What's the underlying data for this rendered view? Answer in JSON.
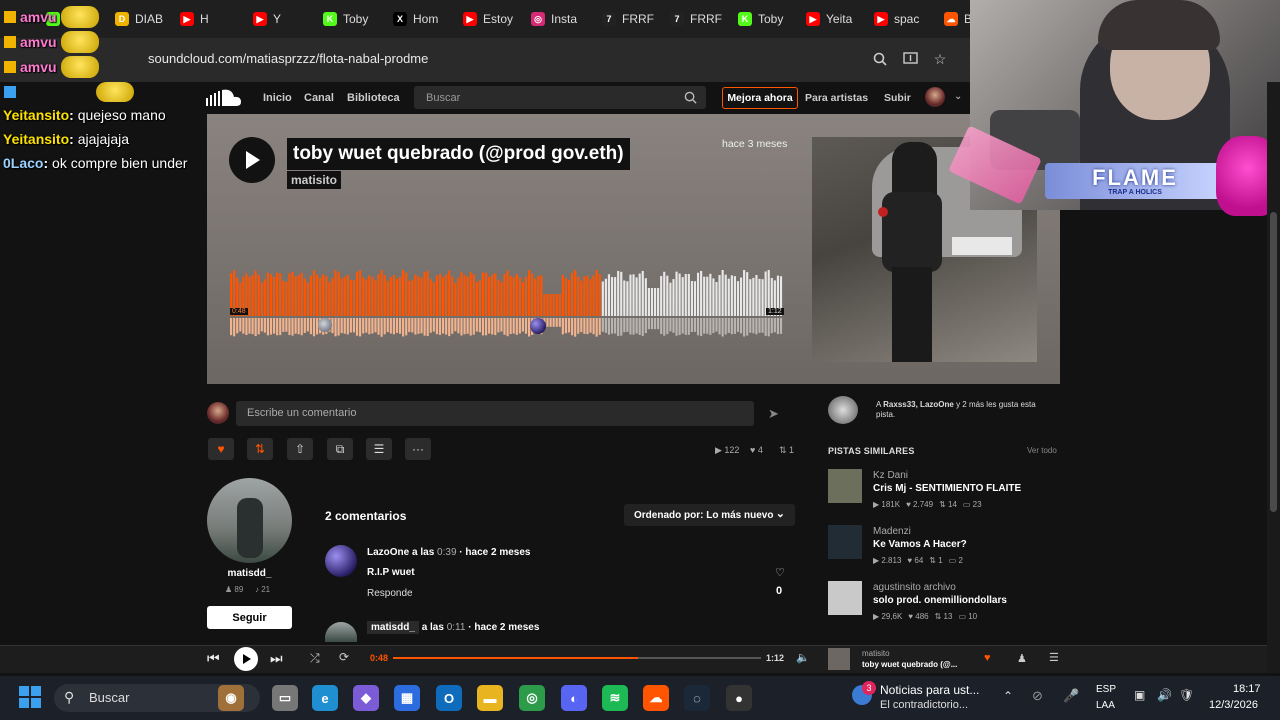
{
  "browser": {
    "tabs": [
      {
        "label": "Toby",
        "icon": "kick-icon",
        "color": "#53fc18"
      },
      {
        "label": "DIAB",
        "icon": "dice-icon",
        "color": "#f0b400"
      },
      {
        "label": "H",
        "icon": "youtube-icon",
        "color": "#ff0000"
      },
      {
        "label": "Y",
        "icon": "youtube-icon",
        "color": "#ff0000"
      },
      {
        "label": "Toby",
        "icon": "kick-icon",
        "color": "#53fc18"
      },
      {
        "label": "Hom",
        "icon": "x-icon",
        "color": "#000000"
      },
      {
        "label": "Estoy",
        "icon": "youtube-icon",
        "color": "#ff0000"
      },
      {
        "label": "Insta",
        "icon": "instagram-icon",
        "color": "#d62976"
      },
      {
        "label": "FRRF",
        "icon": "frrf-icon",
        "color": "#222222"
      },
      {
        "label": "FRRF",
        "icon": "frrf-icon",
        "color": "#222222"
      },
      {
        "label": "Toby",
        "icon": "kick-icon",
        "color": "#53fc18"
      },
      {
        "label": "Yeita",
        "icon": "youtube-icon",
        "color": "#ff0000"
      },
      {
        "label": "spac",
        "icon": "youtube-icon",
        "color": "#ff0000"
      },
      {
        "label": "B",
        "icon": "soundcloud-icon",
        "color": "#ff5500"
      }
    ],
    "url": "soundcloud.com/matiasprzzz/flota-nabal-prodme"
  },
  "chat": {
    "overlay_names": [
      "amvu",
      "amvu",
      "amvu"
    ],
    "messages": [
      {
        "user": "Yeitansito",
        "sep": ":",
        "text": " quejeso mano"
      },
      {
        "user": "Yeitansito",
        "sep": ":",
        "text": " ajajajaja"
      },
      {
        "user": "0Laco",
        "sep": ":",
        "text": " ok compre bien under"
      }
    ]
  },
  "soundcloud": {
    "nav": {
      "home": "Inicio",
      "feed": "Canal",
      "library": "Biblioteca",
      "search_placeholder": "Buscar",
      "upgrade": "Mejora ahora",
      "artists": "Para artistas",
      "upload": "Subir"
    },
    "track": {
      "title": "toby wuet quebrado (@prod gov.eth)",
      "artist": "matisito",
      "posted": "hace 3 meses",
      "time_current": "0:48",
      "time_total": "1:12",
      "progress": 0.667
    },
    "comment_placeholder": "Escribe un comentario",
    "stats": {
      "plays": "122",
      "likes": "4",
      "reposts": "1"
    },
    "uploader": {
      "name": "matisdd_",
      "followers": "89",
      "tracks": "21",
      "follow_label": "Seguir"
    },
    "comments": {
      "count_label": "2 comentarios",
      "sort_label": "Ordenado por: Lo más nuevo",
      "items": [
        {
          "user": "LazoOne",
          "at": "a las",
          "time": "0:39",
          "ago": "· hace 2 meses",
          "text": "R.I.P wuet",
          "reply": "Responde",
          "likes": "0"
        },
        {
          "user": "matisdd_",
          "at": "a las",
          "time": "0:11",
          "ago": "· hace 2 meses"
        }
      ]
    },
    "likes_line": {
      "prefix": "A",
      "names": "Raxss33, LazoOne",
      "suffix": "y 2 más les gusta esta pista."
    },
    "similar": {
      "title": "PISTAS SIMILARES",
      "see_all": "Ver todo",
      "items": [
        {
          "user": "Kz Dani",
          "title": "Cris Mj - SENTIMIENTO FLAITE",
          "plays": "181K",
          "likes": "2.749",
          "reposts": "14",
          "comments": "23"
        },
        {
          "user": "Madenzi",
          "title": "Ke Vamos A Hacer?",
          "plays": "2.813",
          "likes": "64",
          "reposts": "1",
          "comments": "2"
        },
        {
          "user": "agustinsito archivo",
          "title": "solo prod. onemilliondollars",
          "plays": "29,6K",
          "likes": "486",
          "reposts": "13",
          "comments": "10"
        }
      ]
    },
    "player": {
      "current": "0:48",
      "total": "1:12",
      "progress": 0.667,
      "artist": "matisito",
      "title": "toby wuet quebrado (@..."
    }
  },
  "webcam": {
    "logo_text": "FLAME",
    "logo_sub": "TRAP A HOLICS"
  },
  "taskbar": {
    "search_placeholder": "Buscar",
    "news_title": "Noticias para ust...",
    "news_sub": "El contradictorio...",
    "news_badge": "3",
    "lang_top": "ESP",
    "lang_bottom": "LAA",
    "time": "18:17",
    "date": "12/3/2026"
  },
  "colors": {
    "accent": "#ff5500",
    "upgrade_border": "#ff5500",
    "wave_played": "#ff5500",
    "wave_unplayed": "#e8e8e8"
  }
}
